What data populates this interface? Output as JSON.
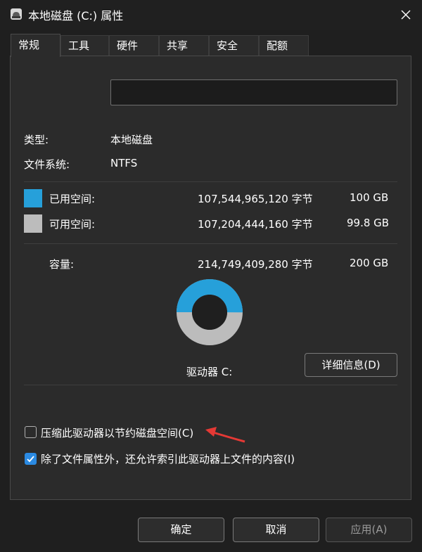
{
  "window": {
    "title": "本地磁盘 (C:) 属性",
    "icon": "drive-icon",
    "close_icon": "close-icon"
  },
  "tabs": [
    {
      "label": "常规",
      "active": true
    },
    {
      "label": "工具",
      "active": false
    },
    {
      "label": "硬件",
      "active": false
    },
    {
      "label": "共享",
      "active": false
    },
    {
      "label": "安全",
      "active": false
    },
    {
      "label": "配额",
      "active": false
    }
  ],
  "general": {
    "volume_name_value": "",
    "type_label": "类型:",
    "type_value": "本地磁盘",
    "fs_label": "文件系统:",
    "fs_value": "NTFS",
    "used": {
      "label": "已用空间:",
      "bytes": "107,544,965,120 字节",
      "size": "100 GB",
      "color": "#26a0da"
    },
    "free": {
      "label": "可用空间:",
      "bytes": "107,204,444,160 字节",
      "size": "99.8 GB",
      "color": "#bcbcbc"
    },
    "capacity": {
      "label": "容量:",
      "bytes": "214,749,409,280 字节",
      "size": "200 GB"
    },
    "used_fraction": 0.5008,
    "drive_label": "驱动器 C:",
    "details_button": "详细信息(D)",
    "compress_checkbox": {
      "label": "压缩此驱动器以节约磁盘空间(C)",
      "checked": false
    },
    "index_checkbox": {
      "label": "除了文件属性外，还允许索引此驱动器上文件的内容(I)",
      "checked": true
    }
  },
  "footer": {
    "ok": "确定",
    "cancel": "取消",
    "apply": "应用(A)"
  },
  "colors": {
    "accent": "#2b8ae2",
    "annotation_arrow": "#e53935"
  }
}
